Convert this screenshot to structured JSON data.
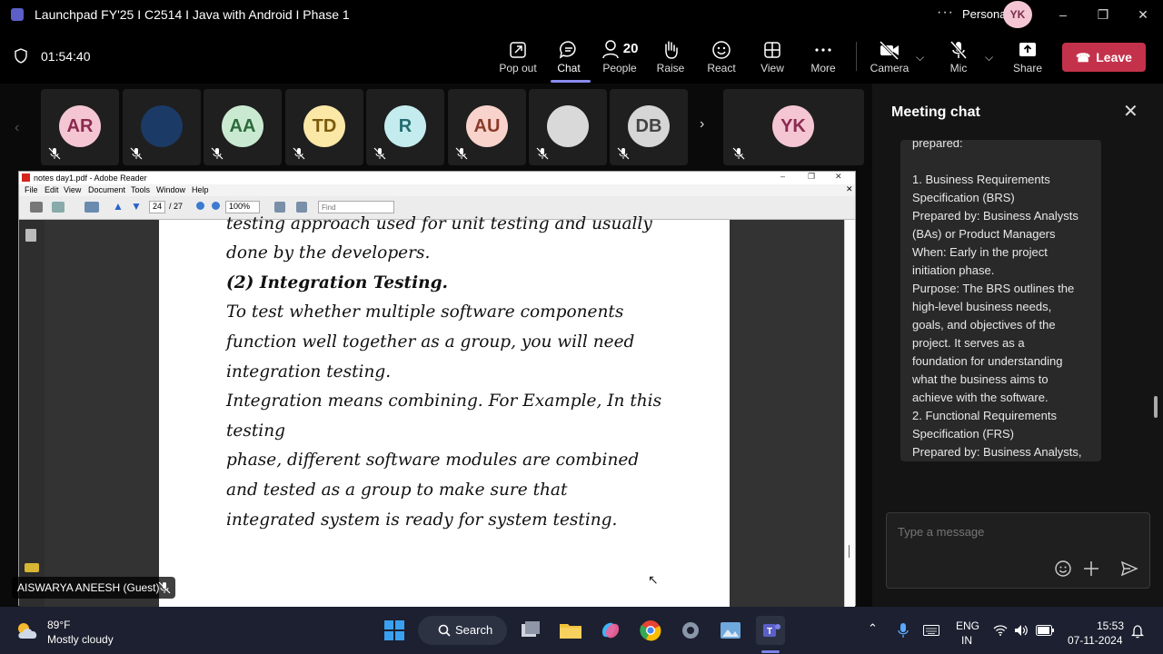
{
  "window": {
    "title": "Launchpad FY'25 I C2514 I Java with Android I Phase 1",
    "more_dots": "···",
    "account_label": "Personal",
    "avatar_initials": "YK"
  },
  "toolbar": {
    "timer": "01:54:40",
    "buttons": [
      {
        "label": "Pop out",
        "icon": "popout-icon"
      },
      {
        "label": "Chat",
        "icon": "chat-icon"
      },
      {
        "label": "People",
        "icon": "people-icon",
        "count": "20"
      },
      {
        "label": "Raise",
        "icon": "hand-icon"
      },
      {
        "label": "React",
        "icon": "smile-icon"
      },
      {
        "label": "View",
        "icon": "grid-icon"
      },
      {
        "label": "More",
        "icon": "more-icon"
      },
      {
        "label": "Camera",
        "icon": "camera-off-icon"
      },
      {
        "label": "Mic",
        "icon": "mic-off-icon"
      },
      {
        "label": "Share",
        "icon": "share-icon"
      }
    ],
    "leave_label": "Leave"
  },
  "participants": [
    {
      "initials": "AR",
      "bg": "#f4c6d4",
      "fg": "#8a2a4f"
    },
    {
      "initials": "",
      "bg": "#1b3a66",
      "fg": "#ffffff",
      "avatar_type": "rocket-avatar"
    },
    {
      "initials": "AA",
      "bg": "#c9ead1",
      "fg": "#2b6a3a"
    },
    {
      "initials": "TD",
      "bg": "#fbe7a6",
      "fg": "#7a5a0a"
    },
    {
      "initials": "R",
      "bg": "#c4ecef",
      "fg": "#236c72"
    },
    {
      "initials": "AU",
      "bg": "#f8d3cb",
      "fg": "#8a3a2a"
    },
    {
      "initials": "",
      "bg": "#d9d9d9",
      "fg": "#333333",
      "avatar_type": "photo-avatar"
    },
    {
      "initials": "DB",
      "bg": "#d6d6d6",
      "fg": "#444444"
    }
  ],
  "self_tile": {
    "initials": "YK",
    "bg": "#f4c6d4",
    "fg": "#8a2a4f"
  },
  "pdf": {
    "title": "notes day1.pdf - Adobe Reader",
    "menu": [
      "File",
      "Edit",
      "View",
      "Document",
      "Tools",
      "Window",
      "Help"
    ],
    "page_current": "24",
    "page_total": "/ 27",
    "zoom": "100%",
    "find_placeholder": "Find",
    "lines": [
      {
        "text": "testing approach used for unit testing and usually",
        "bold": false
      },
      {
        "text": "done by the developers.",
        "bold": false
      },
      {
        "text": "(2) Integration Testing.",
        "bold": true
      },
      {
        "text": "To test whether multiple software components",
        "bold": false
      },
      {
        "text": "function well together as a group, you will need",
        "bold": false
      },
      {
        "text": "integration testing.",
        "bold": false
      },
      {
        "text": "Integration means combining. For Example, In this",
        "bold": false
      },
      {
        "text": "testing",
        "bold": false
      },
      {
        "text": "phase, different software modules are combined",
        "bold": false
      },
      {
        "text": "and tested as a group to make sure that",
        "bold": false
      },
      {
        "text": "integrated system is ready for system testing.",
        "bold": false
      }
    ]
  },
  "presenter": {
    "name": "AISWARYA ANEESH (Guest)"
  },
  "chat": {
    "title": "Meeting chat",
    "message_lines": [
      "prepared:",
      "",
      "1. Business Requirements",
      "Specification (BRS)",
      "Prepared by: Business Analysts",
      "(BAs) or Product Managers",
      "When: Early in the project",
      "initiation phase.",
      "Purpose: The BRS outlines the",
      "high-level business needs,",
      "goals, and objectives of the",
      "project. It serves as a",
      "foundation for understanding",
      "what the business aims to",
      "achieve with the software.",
      "2. Functional Requirements",
      "Specification (FRS)",
      "Prepared by: Business Analysts,"
    ],
    "composer_placeholder": "Type a message"
  },
  "taskbar": {
    "temperature": "89°F",
    "condition": "Mostly cloudy",
    "search_label": "Search",
    "lang_top": "ENG",
    "lang_bottom": "IN",
    "time": "15:53",
    "date": "07-11-2024"
  }
}
